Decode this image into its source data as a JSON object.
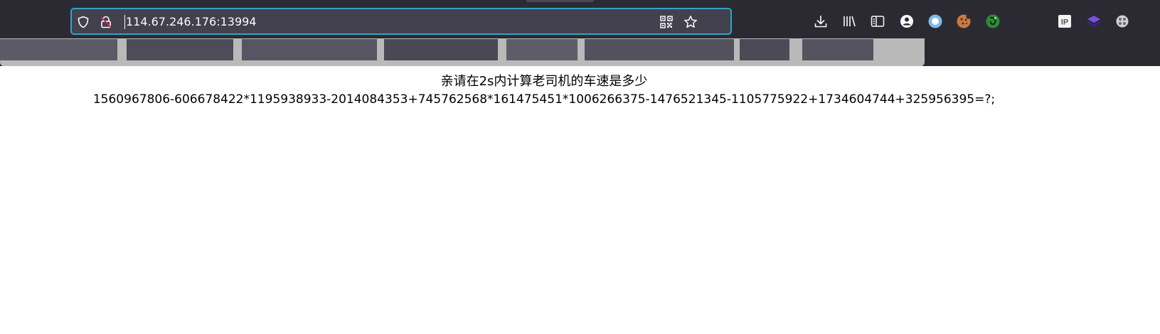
{
  "browser": {
    "address_bar": {
      "url": "114.67.246.176:13994",
      "icons": [
        "shield-icon",
        "insecure-lock-icon",
        "qr-code-icon",
        "bookmark-star-icon"
      ]
    },
    "toolbar_icons": [
      "download-icon",
      "library-icon",
      "sidebar-icon",
      "account-icon",
      "extension-ring-icon",
      "cookie-extension-icon",
      "green-extension-icon",
      "ip-extension-icon",
      "purple-extension-icon",
      "gray-extension-icon"
    ],
    "ip_extension_label": "IP",
    "accent_color": "#2fa5c8",
    "chrome_color": "#2b2a33"
  },
  "page": {
    "prompt": "亲请在2s内计算老司机的车速是多少",
    "expression": "1560967806-606678422*1195938933-2014084353+745762568*161475451*1006266375-1476521345-1105775922+1734604744+325956395=?;"
  }
}
